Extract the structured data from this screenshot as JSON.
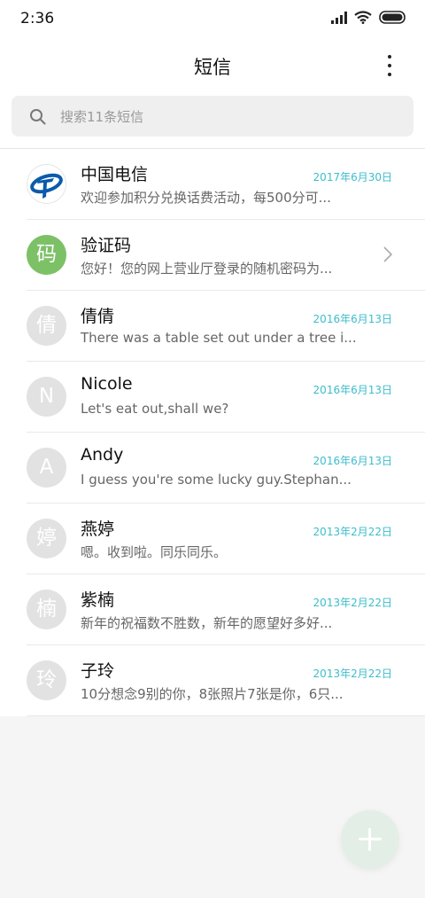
{
  "status": {
    "time": "2:36",
    "icons": [
      "signal-icon",
      "wifi-icon",
      "battery-icon"
    ]
  },
  "header": {
    "title": "短信",
    "menu_icon": "more-vertical-icon"
  },
  "search": {
    "placeholder": "搜索11条短信",
    "icon": "search-icon"
  },
  "conversations": [
    {
      "avatar_char": "",
      "avatar_type": "logo",
      "name": "中国电信",
      "date": "2017年6月30日",
      "preview": "欢迎参加积分兑换话费活动，每500分可..."
    },
    {
      "avatar_char": "码",
      "avatar_type": "green",
      "name": "验证码",
      "date": "",
      "preview": "您好！您的网上营业厅登录的随机密码为..."
    },
    {
      "avatar_char": "倩",
      "avatar_type": "gray",
      "name": "倩倩",
      "date": "2016年6月13日",
      "preview": "There was a table set out under a tree i..."
    },
    {
      "avatar_char": "N",
      "avatar_type": "gray",
      "name": "Nicole",
      "date": "2016年6月13日",
      "preview": "Let's eat out,shall we?"
    },
    {
      "avatar_char": "A",
      "avatar_type": "gray",
      "name": "Andy",
      "date": "2016年6月13日",
      "preview": "I guess you're some lucky guy.Stephan..."
    },
    {
      "avatar_char": "婷",
      "avatar_type": "gray",
      "name": "燕婷",
      "date": "2013年2月22日",
      "preview": "嗯。收到啦。同乐同乐。"
    },
    {
      "avatar_char": "楠",
      "avatar_type": "gray",
      "name": "紫楠",
      "date": "2013年2月22日",
      "preview": "新年的祝福数不胜数，新年的愿望好多好..."
    },
    {
      "avatar_char": "玲",
      "avatar_type": "gray",
      "name": "子玲",
      "date": "2013年2月22日",
      "preview": "10分想念9别的你，8张照片7张是你，6只..."
    }
  ],
  "colors": {
    "date": "#3dbdcc",
    "verify_avatar": "#7dc167",
    "fab": "#e3efe6",
    "telecom_blue": "#0a5bab"
  }
}
